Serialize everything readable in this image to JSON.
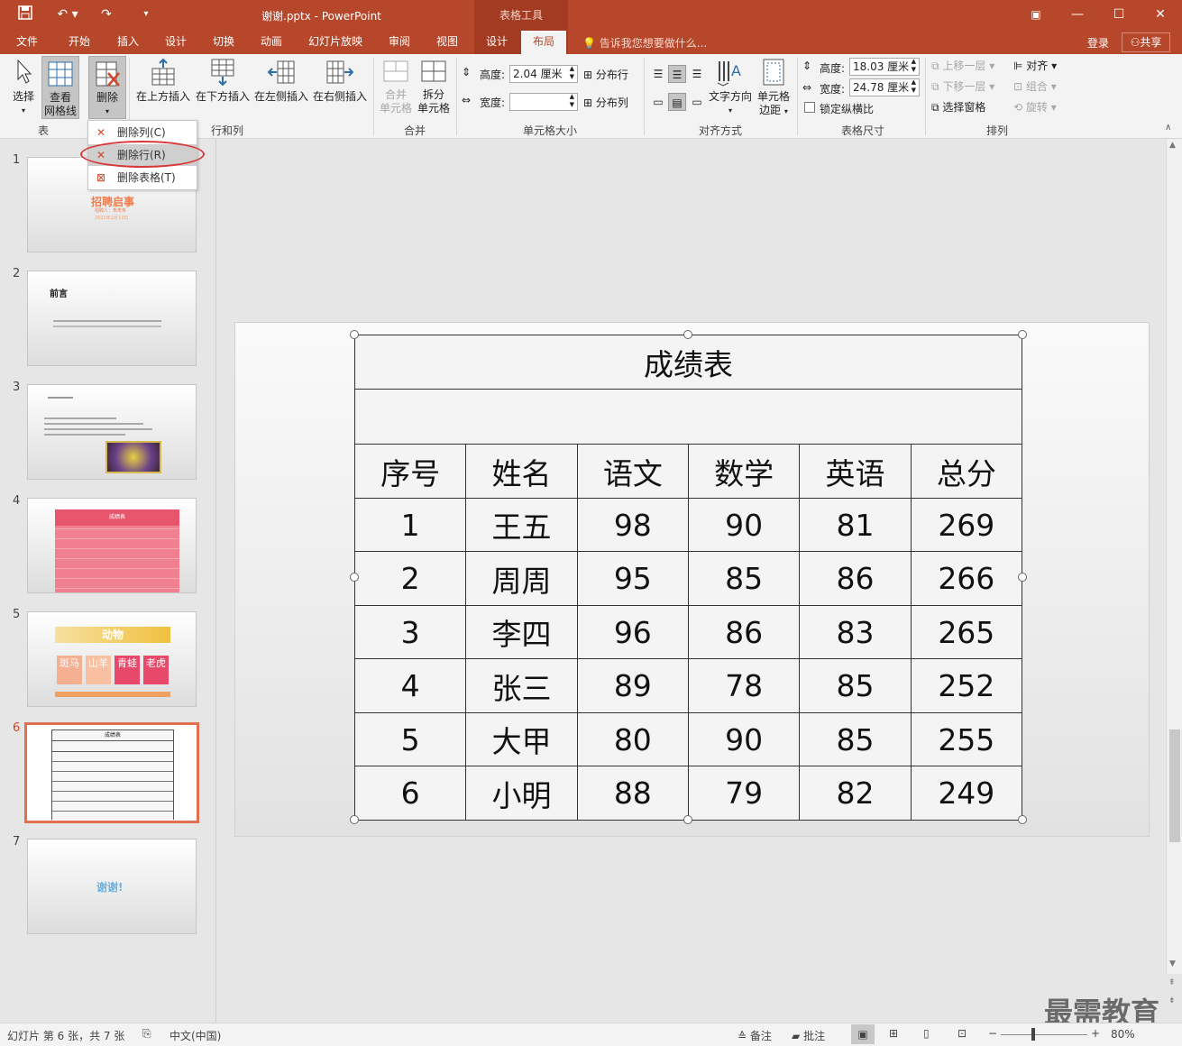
{
  "titlebar": {
    "title": "谢谢.pptx - PowerPoint",
    "context_group": "表格工具",
    "restore_icon": "restore-ribbon-icon"
  },
  "tabs": [
    "文件",
    "开始",
    "插入",
    "设计",
    "切换",
    "动画",
    "幻灯片放映",
    "审阅",
    "视图",
    "设计",
    "布局"
  ],
  "tell_me": "告诉我您想要做什么...",
  "account": {
    "login": "登录",
    "share": "共享"
  },
  "ribbon": {
    "select": "选择",
    "view_grid": [
      "查看",
      "网格线"
    ],
    "delete": "删除",
    "insert_above": "在上方插入",
    "insert_below": "在下方插入",
    "insert_left": "在左侧插入",
    "insert_right": "在右侧插入",
    "merge": [
      "合并",
      "单元格"
    ],
    "split": [
      "拆分",
      "单元格"
    ],
    "height_label": "高度:",
    "height_value": "2.04 厘米",
    "width_label": "宽度:",
    "width_value": "",
    "distribute_rows": "分布行",
    "distribute_cols": "分布列",
    "text_direction": "文字方向",
    "cell_margins": [
      "单元格",
      "边距"
    ],
    "table_height_label": "高度:",
    "table_height_value": "18.03 厘米",
    "table_width_label": "宽度:",
    "table_width_value": "24.78 厘米",
    "lock_ratio": "锁定纵横比",
    "bring_forward": "上移一层",
    "send_backward": "下移一层",
    "selection_pane": "选择窗格",
    "align": "对齐",
    "group": "组合",
    "rotate": "旋转",
    "groups": [
      "表",
      "行和列",
      "合并",
      "单元格大小",
      "对齐方式",
      "表格尺寸",
      "排列"
    ]
  },
  "delete_menu": [
    "删除列(C)",
    "删除行(R)",
    "删除表格(T)"
  ],
  "thumbnails": [
    {
      "num": "1",
      "title": "招聘启事",
      "sub1": "招聘人：朱朱朱",
      "sub2": "2021年1月12日"
    },
    {
      "num": "2",
      "title": "前言"
    },
    {
      "num": "3"
    },
    {
      "num": "4",
      "title": "成绩表"
    },
    {
      "num": "5",
      "title": "动物",
      "cells": [
        "斑马",
        "山羊",
        "青蛙",
        "老虎"
      ]
    },
    {
      "num": "6",
      "title": "成绩表"
    },
    {
      "num": "7",
      "title": "谢谢!"
    }
  ],
  "table": {
    "title": "成绩表",
    "headers": [
      "序号",
      "姓名",
      "语文",
      "数学",
      "英语",
      "总分"
    ],
    "rows": [
      [
        "1",
        "王五",
        "98",
        "90",
        "81",
        "269"
      ],
      [
        "2",
        "周周",
        "95",
        "85",
        "86",
        "266"
      ],
      [
        "3",
        "李四",
        "96",
        "86",
        "83",
        "265"
      ],
      [
        "4",
        "张三",
        "89",
        "78",
        "85",
        "252"
      ],
      [
        "5",
        "大甲",
        "80",
        "90",
        "85",
        "255"
      ],
      [
        "6",
        "小明",
        "88",
        "79",
        "82",
        "249"
      ]
    ]
  },
  "statusbar": {
    "slide_info": "幻灯片 第 6 张，共 7 张",
    "language": "中文(中国)",
    "notes": "备注",
    "comments": "批注",
    "zoom": "80%"
  },
  "watermark": "最需教育",
  "colors": {
    "accent": "#b7472a",
    "highlight_circle": "#d9383a",
    "selected_thumb": "#e07050"
  }
}
